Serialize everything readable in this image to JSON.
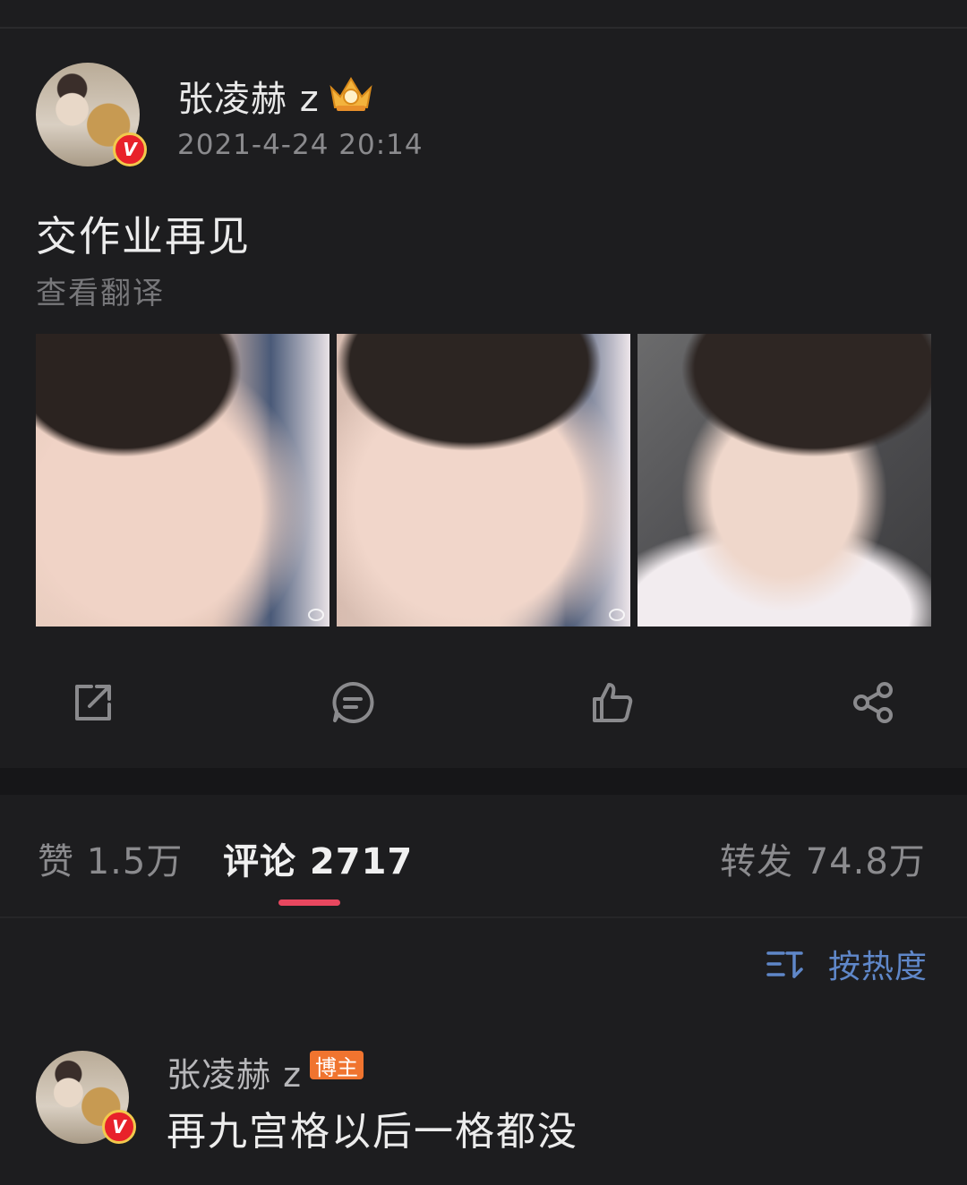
{
  "post": {
    "username": "张凌赫 z",
    "timestamp": "2021-4-24 20:14",
    "text": "交作业再见",
    "translate_link": "查看翻译",
    "photos": [
      "photo-1",
      "photo-2",
      "photo-3"
    ]
  },
  "actions": {
    "icons": [
      "repost-icon",
      "comment-icon",
      "like-icon",
      "share-icon"
    ]
  },
  "tabs": {
    "likes": "赞 1.5万",
    "comments": "评论 2717",
    "reposts": "转发 74.8万",
    "active": "comments"
  },
  "sort": {
    "label": "按热度",
    "icon": "sort-icon"
  },
  "comment": {
    "username": "张凌赫 z",
    "badge": "博主",
    "text": "再九宫格以后一格都没"
  },
  "colors": {
    "background": "#1d1d1f",
    "accent": "#e8475f",
    "link_blue": "#5f87c9",
    "badge_orange": "#f0742f",
    "verified_red": "#e8222a"
  }
}
